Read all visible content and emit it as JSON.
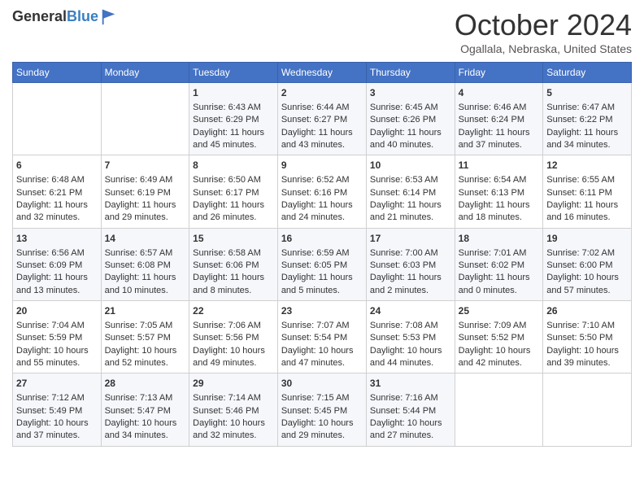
{
  "header": {
    "logo_general": "General",
    "logo_blue": "Blue",
    "month_title": "October 2024",
    "location": "Ogallala, Nebraska, United States"
  },
  "days_of_week": [
    "Sunday",
    "Monday",
    "Tuesday",
    "Wednesday",
    "Thursday",
    "Friday",
    "Saturday"
  ],
  "weeks": [
    [
      {
        "day": "",
        "content": ""
      },
      {
        "day": "",
        "content": ""
      },
      {
        "day": "1",
        "content": "Sunrise: 6:43 AM\nSunset: 6:29 PM\nDaylight: 11 hours and 45 minutes."
      },
      {
        "day": "2",
        "content": "Sunrise: 6:44 AM\nSunset: 6:27 PM\nDaylight: 11 hours and 43 minutes."
      },
      {
        "day": "3",
        "content": "Sunrise: 6:45 AM\nSunset: 6:26 PM\nDaylight: 11 hours and 40 minutes."
      },
      {
        "day": "4",
        "content": "Sunrise: 6:46 AM\nSunset: 6:24 PM\nDaylight: 11 hours and 37 minutes."
      },
      {
        "day": "5",
        "content": "Sunrise: 6:47 AM\nSunset: 6:22 PM\nDaylight: 11 hours and 34 minutes."
      }
    ],
    [
      {
        "day": "6",
        "content": "Sunrise: 6:48 AM\nSunset: 6:21 PM\nDaylight: 11 hours and 32 minutes."
      },
      {
        "day": "7",
        "content": "Sunrise: 6:49 AM\nSunset: 6:19 PM\nDaylight: 11 hours and 29 minutes."
      },
      {
        "day": "8",
        "content": "Sunrise: 6:50 AM\nSunset: 6:17 PM\nDaylight: 11 hours and 26 minutes."
      },
      {
        "day": "9",
        "content": "Sunrise: 6:52 AM\nSunset: 6:16 PM\nDaylight: 11 hours and 24 minutes."
      },
      {
        "day": "10",
        "content": "Sunrise: 6:53 AM\nSunset: 6:14 PM\nDaylight: 11 hours and 21 minutes."
      },
      {
        "day": "11",
        "content": "Sunrise: 6:54 AM\nSunset: 6:13 PM\nDaylight: 11 hours and 18 minutes."
      },
      {
        "day": "12",
        "content": "Sunrise: 6:55 AM\nSunset: 6:11 PM\nDaylight: 11 hours and 16 minutes."
      }
    ],
    [
      {
        "day": "13",
        "content": "Sunrise: 6:56 AM\nSunset: 6:09 PM\nDaylight: 11 hours and 13 minutes."
      },
      {
        "day": "14",
        "content": "Sunrise: 6:57 AM\nSunset: 6:08 PM\nDaylight: 11 hours and 10 minutes."
      },
      {
        "day": "15",
        "content": "Sunrise: 6:58 AM\nSunset: 6:06 PM\nDaylight: 11 hours and 8 minutes."
      },
      {
        "day": "16",
        "content": "Sunrise: 6:59 AM\nSunset: 6:05 PM\nDaylight: 11 hours and 5 minutes."
      },
      {
        "day": "17",
        "content": "Sunrise: 7:00 AM\nSunset: 6:03 PM\nDaylight: 11 hours and 2 minutes."
      },
      {
        "day": "18",
        "content": "Sunrise: 7:01 AM\nSunset: 6:02 PM\nDaylight: 11 hours and 0 minutes."
      },
      {
        "day": "19",
        "content": "Sunrise: 7:02 AM\nSunset: 6:00 PM\nDaylight: 10 hours and 57 minutes."
      }
    ],
    [
      {
        "day": "20",
        "content": "Sunrise: 7:04 AM\nSunset: 5:59 PM\nDaylight: 10 hours and 55 minutes."
      },
      {
        "day": "21",
        "content": "Sunrise: 7:05 AM\nSunset: 5:57 PM\nDaylight: 10 hours and 52 minutes."
      },
      {
        "day": "22",
        "content": "Sunrise: 7:06 AM\nSunset: 5:56 PM\nDaylight: 10 hours and 49 minutes."
      },
      {
        "day": "23",
        "content": "Sunrise: 7:07 AM\nSunset: 5:54 PM\nDaylight: 10 hours and 47 minutes."
      },
      {
        "day": "24",
        "content": "Sunrise: 7:08 AM\nSunset: 5:53 PM\nDaylight: 10 hours and 44 minutes."
      },
      {
        "day": "25",
        "content": "Sunrise: 7:09 AM\nSunset: 5:52 PM\nDaylight: 10 hours and 42 minutes."
      },
      {
        "day": "26",
        "content": "Sunrise: 7:10 AM\nSunset: 5:50 PM\nDaylight: 10 hours and 39 minutes."
      }
    ],
    [
      {
        "day": "27",
        "content": "Sunrise: 7:12 AM\nSunset: 5:49 PM\nDaylight: 10 hours and 37 minutes."
      },
      {
        "day": "28",
        "content": "Sunrise: 7:13 AM\nSunset: 5:47 PM\nDaylight: 10 hours and 34 minutes."
      },
      {
        "day": "29",
        "content": "Sunrise: 7:14 AM\nSunset: 5:46 PM\nDaylight: 10 hours and 32 minutes."
      },
      {
        "day": "30",
        "content": "Sunrise: 7:15 AM\nSunset: 5:45 PM\nDaylight: 10 hours and 29 minutes."
      },
      {
        "day": "31",
        "content": "Sunrise: 7:16 AM\nSunset: 5:44 PM\nDaylight: 10 hours and 27 minutes."
      },
      {
        "day": "",
        "content": ""
      },
      {
        "day": "",
        "content": ""
      }
    ]
  ]
}
